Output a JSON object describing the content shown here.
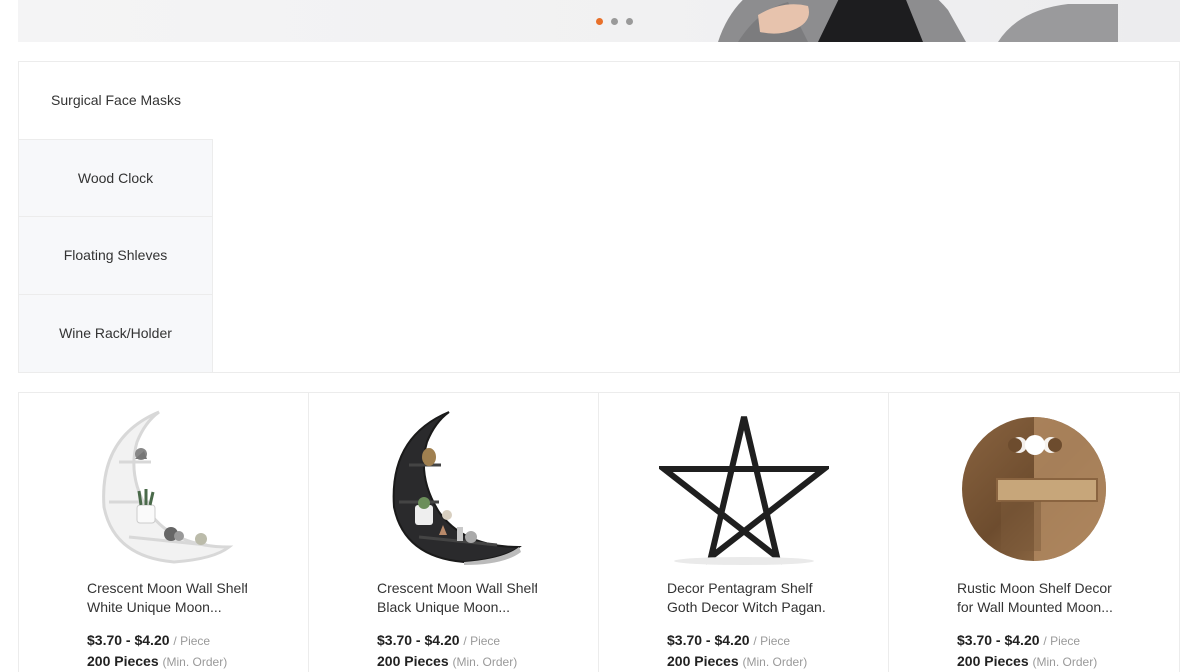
{
  "banner": {
    "dots": 3,
    "active_dot": 0
  },
  "categories": [
    {
      "label": "Surgical Face Masks"
    },
    {
      "label": "Wood Clock"
    },
    {
      "label": "Floating Shleves"
    },
    {
      "label": "Wine Rack/Holder"
    }
  ],
  "products": [
    {
      "title_line1": "Crescent Moon Wall Shelf",
      "title_line2": "White Unique Moon...",
      "price": "$3.70 - $4.20",
      "unit": "/ Piece",
      "moq": "200 Pieces",
      "moq_label": "(Min. Order)",
      "image": "white-crescent-moon-shelf"
    },
    {
      "title_line1": "Crescent Moon Wall Shelf",
      "title_line2": "Black Unique Moon...",
      "price": "$3.70 - $4.20",
      "unit": "/ Piece",
      "moq": "200 Pieces",
      "moq_label": "(Min. Order)",
      "image": "black-crescent-moon-shelf"
    },
    {
      "title_line1": "Decor Pentagram Shelf",
      "title_line2": "Goth Decor Witch Pagan...",
      "price": "$3.70 - $4.20",
      "unit": "/ Piece",
      "moq": "200 Pieces",
      "moq_label": "(Min. Order)",
      "image": "pentagram-shelf"
    },
    {
      "title_line1": "Rustic Moon Shelf Decor",
      "title_line2": "for Wall Mounted Moon...",
      "price": "$3.70 - $4.20",
      "unit": "/ Piece",
      "moq": "200 Pieces",
      "moq_label": "(Min. Order)",
      "image": "rustic-wood-moon-shelf"
    }
  ],
  "colors": {
    "accent": "#e8702a",
    "dot_inactive": "#9a9a9a",
    "border": "#ececec"
  }
}
